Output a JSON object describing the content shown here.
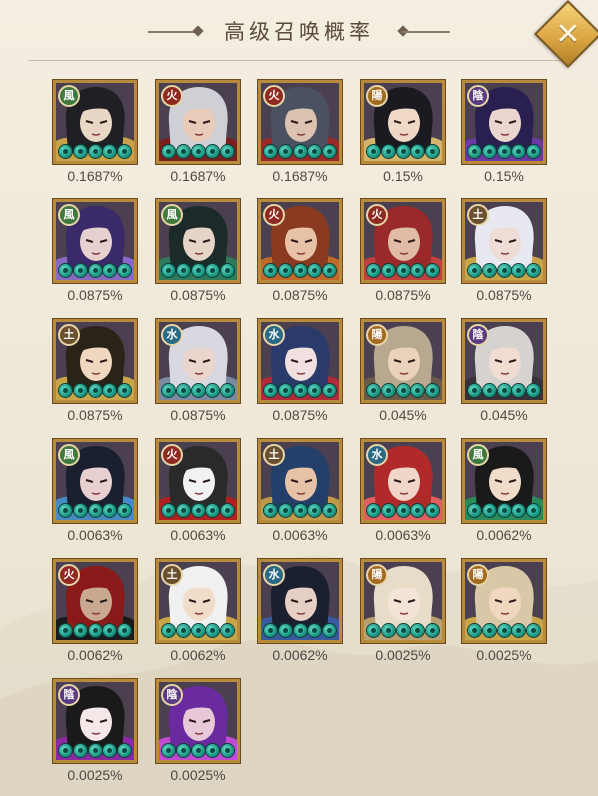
{
  "header": {
    "title": "高级召唤概率",
    "close_label": "✕"
  },
  "element_glyphs": {
    "wind": "風",
    "fire": "火",
    "yang": "陽",
    "yin": "陰",
    "earth": "土",
    "water": "水"
  },
  "cards": [
    {
      "element": "wind",
      "rate": "0.1687%",
      "palette": [
        "#1f1f24",
        "#e9d7c6",
        "#c7a24a"
      ]
    },
    {
      "element": "fire",
      "rate": "0.1687%",
      "palette": [
        "#cfcfd6",
        "#e8cbb8",
        "#7a1f1f"
      ]
    },
    {
      "element": "fire",
      "rate": "0.1687%",
      "palette": [
        "#4a5160",
        "#dcc2b0",
        "#9a2a2a"
      ]
    },
    {
      "element": "yang",
      "rate": "0.15%",
      "palette": [
        "#1a1a20",
        "#f0d8c6",
        "#d4b36a"
      ]
    },
    {
      "element": "yin",
      "rate": "0.15%",
      "palette": [
        "#2a2050",
        "#ead6cf",
        "#6a3aa0"
      ]
    },
    {
      "element": "wind",
      "rate": "0.0875%",
      "palette": [
        "#3a2a6a",
        "#e6d0d0",
        "#8a6ac0"
      ]
    },
    {
      "element": "wind",
      "rate": "0.0875%",
      "palette": [
        "#1c2a2a",
        "#e6d4c6",
        "#2e7a5a"
      ]
    },
    {
      "element": "fire",
      "rate": "0.0875%",
      "palette": [
        "#8a3a20",
        "#e8c2a6",
        "#c06a2a"
      ]
    },
    {
      "element": "fire",
      "rate": "0.0875%",
      "palette": [
        "#9a2a2a",
        "#e0bca6",
        "#c04040"
      ]
    },
    {
      "element": "earth",
      "rate": "0.0875%",
      "palette": [
        "#e8e8f0",
        "#f0dcd6",
        "#c9a54a"
      ]
    },
    {
      "element": "earth",
      "rate": "0.0875%",
      "palette": [
        "#2a2418",
        "#f0d8c0",
        "#c9a54a"
      ]
    },
    {
      "element": "water",
      "rate": "0.0875%",
      "palette": [
        "#d8d8e0",
        "#ead6cc",
        "#7a8aa0"
      ]
    },
    {
      "element": "water",
      "rate": "0.0875%",
      "palette": [
        "#2a3a6a",
        "#f0e0e0",
        "#b02a3a"
      ]
    },
    {
      "element": "yang",
      "rate": "0.045%",
      "palette": [
        "#b8a890",
        "#ead2bc",
        "#6a5a48"
      ]
    },
    {
      "element": "yin",
      "rate": "0.045%",
      "palette": [
        "#d6d2d0",
        "#f0dcd0",
        "#3a3038"
      ]
    },
    {
      "element": "wind",
      "rate": "0.0063%",
      "palette": [
        "#1a2030",
        "#e8d0d0",
        "#4a8ac0"
      ]
    },
    {
      "element": "fire",
      "rate": "0.0063%",
      "palette": [
        "#2a2a2a",
        "#f2f2f2",
        "#b02020"
      ]
    },
    {
      "element": "earth",
      "rate": "0.0063%",
      "palette": [
        "#24406a",
        "#e6c2a6",
        "#c09a4a"
      ]
    },
    {
      "element": "water",
      "rate": "0.0063%",
      "palette": [
        "#b02a2a",
        "#f0d6c8",
        "#e06060"
      ]
    },
    {
      "element": "wind",
      "rate": "0.0062%",
      "palette": [
        "#1a1a1a",
        "#f0dcc8",
        "#2a8a5a"
      ]
    },
    {
      "element": "fire",
      "rate": "0.0062%",
      "palette": [
        "#8a1a1a",
        "#c8a890",
        "#1a1a1a"
      ]
    },
    {
      "element": "earth",
      "rate": "0.0062%",
      "palette": [
        "#f0f0f0",
        "#f0dcc8",
        "#c9a54a"
      ]
    },
    {
      "element": "water",
      "rate": "0.0062%",
      "palette": [
        "#1a2030",
        "#e6d0c6",
        "#3a5aa0"
      ]
    },
    {
      "element": "yang",
      "rate": "0.0025%",
      "palette": [
        "#e6dcc8",
        "#f4e4d8",
        "#b8a070"
      ]
    },
    {
      "element": "yang",
      "rate": "0.0025%",
      "palette": [
        "#d8c8a8",
        "#f0d8c0",
        "#c9a54a"
      ]
    },
    {
      "element": "yin",
      "rate": "0.0025%",
      "palette": [
        "#1a1a1a",
        "#f4e8e8",
        "#8a2aa0"
      ]
    },
    {
      "element": "yin",
      "rate": "0.0025%",
      "palette": [
        "#6a2aa0",
        "#e8c8d8",
        "#c04ad0"
      ]
    }
  ]
}
